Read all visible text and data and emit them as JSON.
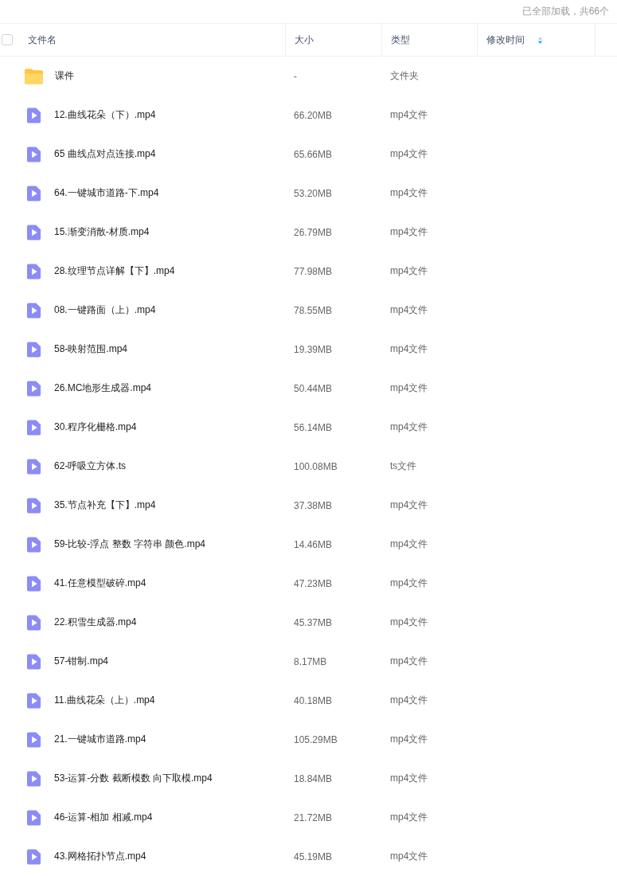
{
  "status": "已全部加载，共66个",
  "header": {
    "checkbox": {
      "checked": false
    },
    "columns": [
      "文件名",
      "大小",
      "类型",
      "修改时间"
    ]
  },
  "rows": [
    {
      "kind": "folder",
      "name": "课件",
      "size": "-",
      "type": "文件夹"
    },
    {
      "kind": "video",
      "name": "12.曲线花朵（下）.mp4",
      "size": "66.20MB",
      "type": "mp4文件"
    },
    {
      "kind": "video",
      "name": "65 曲线点对点连接.mp4",
      "size": "65.66MB",
      "type": "mp4文件"
    },
    {
      "kind": "video",
      "name": "64.一键城市道路-下.mp4",
      "size": "53.20MB",
      "type": "mp4文件"
    },
    {
      "kind": "video",
      "name": "15.渐变消散-材质.mp4",
      "size": "26.79MB",
      "type": "mp4文件"
    },
    {
      "kind": "video",
      "name": "28.纹理节点详解【下】.mp4",
      "size": "77.98MB",
      "type": "mp4文件"
    },
    {
      "kind": "video",
      "name": "08.一键路面（上）.mp4",
      "size": "78.55MB",
      "type": "mp4文件"
    },
    {
      "kind": "video",
      "name": "58-映射范围.mp4",
      "size": "19.39MB",
      "type": "mp4文件"
    },
    {
      "kind": "video",
      "name": "26.MC地形生成器.mp4",
      "size": "50.44MB",
      "type": "mp4文件"
    },
    {
      "kind": "video",
      "name": "30.程序化栅格.mp4",
      "size": "56.14MB",
      "type": "mp4文件"
    },
    {
      "kind": "video",
      "name": "62-呼吸立方体.ts",
      "size": "100.08MB",
      "type": "ts文件"
    },
    {
      "kind": "video",
      "name": "35.节点补充【下】.mp4",
      "size": "37.38MB",
      "type": "mp4文件"
    },
    {
      "kind": "video",
      "name": "59-比较-浮点 整数 字符串 颜色.mp4",
      "size": "14.46MB",
      "type": "mp4文件"
    },
    {
      "kind": "video",
      "name": "41.任意模型破碎.mp4",
      "size": "47.23MB",
      "type": "mp4文件"
    },
    {
      "kind": "video",
      "name": "22.积雪生成器.mp4",
      "size": "45.37MB",
      "type": "mp4文件"
    },
    {
      "kind": "video",
      "name": "57-钳制.mp4",
      "size": "8.17MB",
      "type": "mp4文件"
    },
    {
      "kind": "video",
      "name": "11.曲线花朵（上）.mp4",
      "size": "40.18MB",
      "type": "mp4文件"
    },
    {
      "kind": "video",
      "name": "21.一键城市道路.mp4",
      "size": "105.29MB",
      "type": "mp4文件"
    },
    {
      "kind": "video",
      "name": "53-运算-分数 截断模数 向下取模.mp4",
      "size": "18.84MB",
      "type": "mp4文件"
    },
    {
      "kind": "video",
      "name": "46-运算-相加 相减.mp4",
      "size": "21.72MB",
      "type": "mp4文件"
    },
    {
      "kind": "video",
      "name": "43.网格拓扑节点.mp4",
      "size": "45.19MB",
      "type": "mp4文件"
    }
  ]
}
